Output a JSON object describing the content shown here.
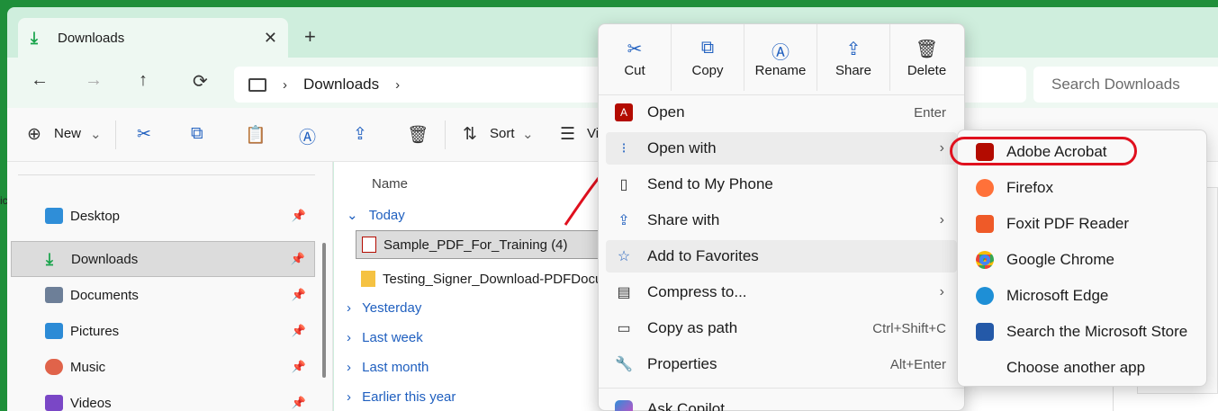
{
  "tab": {
    "title": "Downloads",
    "close": "✕",
    "new": "+"
  },
  "nav": {
    "back": "←",
    "forward": "→",
    "up": "↑",
    "refresh": "⟳",
    "chev": "›",
    "location": "Downloads",
    "search_placeholder": "Search Downloads"
  },
  "toolbar": {
    "new": "New",
    "sort": "Sort",
    "view": "Vi",
    "caret": "⌄"
  },
  "sidebar": {
    "items": [
      {
        "label": "Desktop",
        "color": "#2f8ed8"
      },
      {
        "label": "Downloads",
        "color": "#17a34a"
      },
      {
        "label": "Documents",
        "color": "#6d7f98"
      },
      {
        "label": "Pictures",
        "color": "#2c8bd6"
      },
      {
        "label": "Music",
        "color": "#e0634a"
      },
      {
        "label": "Videos",
        "color": "#7a47c6"
      }
    ],
    "pin": "📌"
  },
  "files": {
    "column": "Name",
    "groups": {
      "today": "Today",
      "yesterday": "Yesterday",
      "lastweek": "Last week",
      "lastmonth": "Last month",
      "earlier": "Earlier this year"
    },
    "items": [
      "Sample_PDF_For_Training (4)",
      "Testing_Signer_Download-PDFDocu"
    ],
    "expand_open": "⌄",
    "expand_closed": "›"
  },
  "context_menu": {
    "top": [
      {
        "label": "Cut",
        "icon": "✂"
      },
      {
        "label": "Copy",
        "icon": "⧉"
      },
      {
        "label": "Rename",
        "icon": "Ⓐ"
      },
      {
        "label": "Share",
        "icon": "⇪"
      },
      {
        "label": "Delete",
        "icon": "🗑"
      }
    ],
    "items": [
      {
        "label": "Open",
        "shortcut": "Enter"
      },
      {
        "label": "Open with",
        "arrow": "›"
      },
      {
        "label": "Send to My Phone"
      },
      {
        "label": "Share with",
        "arrow": "›"
      },
      {
        "label": "Add to Favorites",
        "icon": "☆"
      },
      {
        "label": "Compress to...",
        "arrow": "›"
      },
      {
        "label": "Copy as path",
        "shortcut": "Ctrl+Shift+C"
      },
      {
        "label": "Properties",
        "shortcut": "Alt+Enter",
        "icon": "🔧"
      },
      {
        "label": "Ask Copilot"
      }
    ]
  },
  "open_with": {
    "items": [
      {
        "label": "Adobe Acrobat",
        "color": "#b30b00"
      },
      {
        "label": "Firefox",
        "color": "#ff7139"
      },
      {
        "label": "Foxit PDF Reader",
        "color": "#ef5a28"
      },
      {
        "label": "Google Chrome",
        "color": "#4285f4"
      },
      {
        "label": "Microsoft Edge",
        "color": "#1e8fd6"
      },
      {
        "label": "Search the Microsoft Store",
        "color": "#2459a8"
      },
      {
        "label": "Choose another app",
        "color": ""
      }
    ]
  },
  "colors": {
    "accent": "#1f5fbf",
    "annotation": "#e0101e"
  }
}
